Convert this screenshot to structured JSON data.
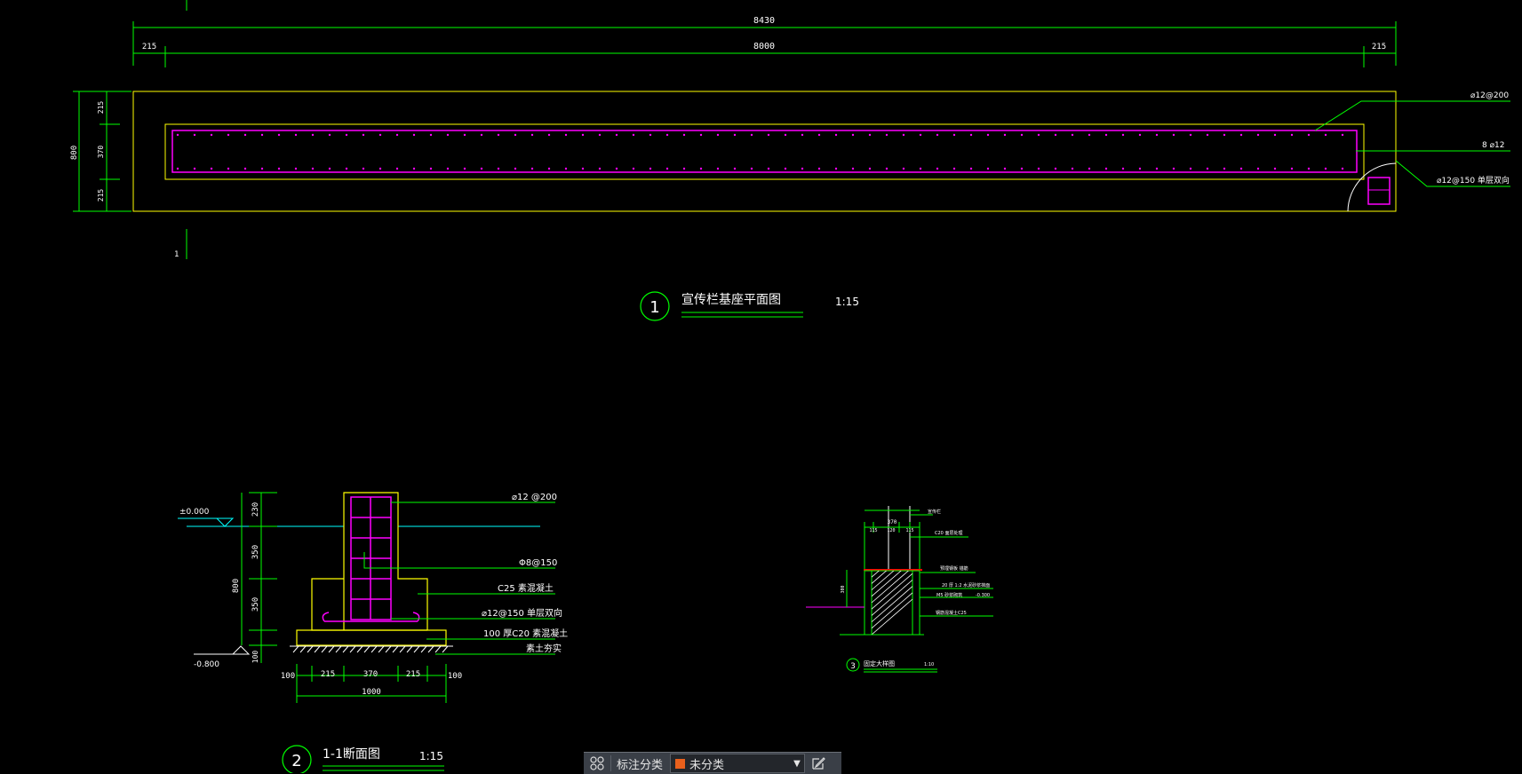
{
  "plan": {
    "dim_total": "8430",
    "dim_left": "215",
    "dim_mid": "8000",
    "dim_right": "215",
    "dim_v_total": "800",
    "dim_v_top": "215",
    "dim_v_mid": "370",
    "dim_v_bot": "215",
    "note_top_bar": "⌀12@200",
    "note_side_bar": "8 ⌀12",
    "note_bottom_bar": "⌀12@150  单层双向",
    "section_mark": "1",
    "title_no": "1",
    "title": "宣传栏基座平面图",
    "scale": "1:15"
  },
  "section": {
    "elev_top": "±0.000",
    "elev_bottom": "-0.800",
    "dim_v1": "230",
    "dim_v2": "350",
    "dim_v3": "350",
    "dim_v4": "100",
    "dim_v_total": "800",
    "note_1": "⌀12  @200",
    "note_2": "Φ8@150",
    "note_3": "C25  素混凝土",
    "note_4": "⌀12@150   单层双向",
    "note_5": "100  厚C20  素混凝土",
    "note_6": "素土夯实",
    "dim_h1": "100",
    "dim_h2": "215",
    "dim_h3": "370",
    "dim_h4": "215",
    "dim_h5": "100",
    "dim_h_total": "1000",
    "title_no": "2",
    "title": "1-1断面图",
    "scale": "1:15"
  },
  "detail": {
    "n1": "宣传栏",
    "n2": "C20  面层处理",
    "n3": "预埋钢板  锚筋",
    "n4": "20 厚 1:2 水泥砂浆抹面",
    "n5": "M5 砂浆砌筑",
    "n6": "钢筋混凝土C25",
    "n7": "-0.300",
    "d1": "370",
    "d2": "115",
    "d3": "120",
    "d4": "115",
    "d5": "300",
    "title_no": "3",
    "title": "固定大样图",
    "scale": "1:10"
  },
  "toolbar": {
    "grid_icon": "grid-icon",
    "label": "标注分类",
    "dropdown_value": "未分类",
    "swatch_color": "#e8601c",
    "edit_icon": "edit-icon"
  },
  "colors": {
    "dim": "#00ff00",
    "outline": "#ffff00",
    "rebar": "#ff00ff",
    "text": "#ffffff",
    "ground": "#00ffff",
    "cut": "#ff0000"
  }
}
